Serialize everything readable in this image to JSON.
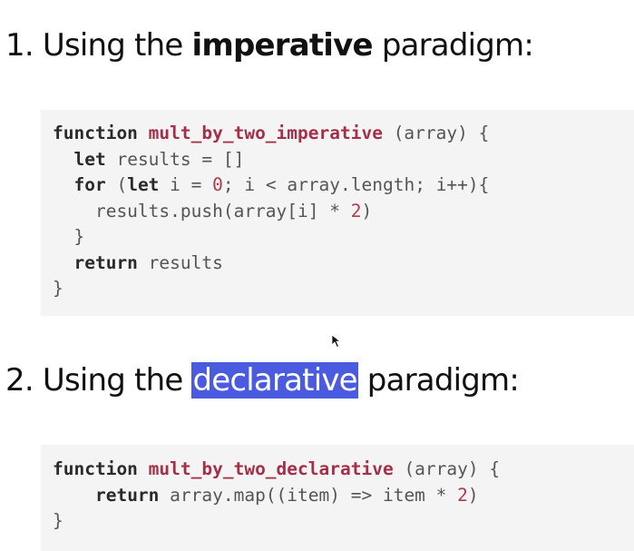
{
  "section1": {
    "number": "1.",
    "prefix": "Using the",
    "emphasis": "imperative",
    "suffix": "paradigm:"
  },
  "code1": {
    "lines": [
      {
        "tokens": [
          {
            "t": "kw",
            "v": "function"
          },
          {
            "t": "sp",
            "v": " "
          },
          {
            "t": "fn",
            "v": "mult_by_two_imperative"
          },
          {
            "t": "tx",
            "v": " (array) {"
          }
        ]
      },
      {
        "tokens": [
          {
            "t": "sp",
            "v": "  "
          },
          {
            "t": "kw",
            "v": "let"
          },
          {
            "t": "tx",
            "v": " results = []"
          }
        ]
      },
      {
        "tokens": [
          {
            "t": "sp",
            "v": "  "
          },
          {
            "t": "kw",
            "v": "for"
          },
          {
            "t": "tx",
            "v": " ("
          },
          {
            "t": "kw",
            "v": "let"
          },
          {
            "t": "tx",
            "v": " i = "
          },
          {
            "t": "num",
            "v": "0"
          },
          {
            "t": "tx",
            "v": "; i < array.length; i++){"
          }
        ]
      },
      {
        "tokens": [
          {
            "t": "tx",
            "v": "    results.push(array[i] * "
          },
          {
            "t": "num",
            "v": "2"
          },
          {
            "t": "tx",
            "v": ")"
          }
        ]
      },
      {
        "tokens": [
          {
            "t": "tx",
            "v": "  }"
          }
        ]
      },
      {
        "tokens": [
          {
            "t": "sp",
            "v": "  "
          },
          {
            "t": "kw",
            "v": "return"
          },
          {
            "t": "tx",
            "v": " results"
          }
        ]
      },
      {
        "tokens": [
          {
            "t": "tx",
            "v": "}"
          }
        ]
      }
    ]
  },
  "section2": {
    "number": "2.",
    "prefix": "Using the",
    "emphasis": "declarative",
    "suffix": "paradigm:"
  },
  "code2": {
    "lines": [
      {
        "tokens": [
          {
            "t": "kw",
            "v": "function"
          },
          {
            "t": "sp",
            "v": " "
          },
          {
            "t": "fn",
            "v": "mult_by_two_declarative"
          },
          {
            "t": "tx",
            "v": " (array) {"
          }
        ]
      },
      {
        "tokens": [
          {
            "t": "sp",
            "v": "    "
          },
          {
            "t": "kw",
            "v": "return"
          },
          {
            "t": "tx",
            "v": " array.map((item) => item * "
          },
          {
            "t": "num",
            "v": "2"
          },
          {
            "t": "tx",
            "v": ")"
          }
        ]
      },
      {
        "tokens": [
          {
            "t": "tx",
            "v": "}"
          }
        ]
      }
    ]
  },
  "colors": {
    "highlight": "#4a5be0",
    "code_background": "#f4f4f4",
    "function_name": "#a33048",
    "number_literal": "#b03a4a"
  },
  "cursor": {
    "icon": "mouse-pointer-icon"
  }
}
